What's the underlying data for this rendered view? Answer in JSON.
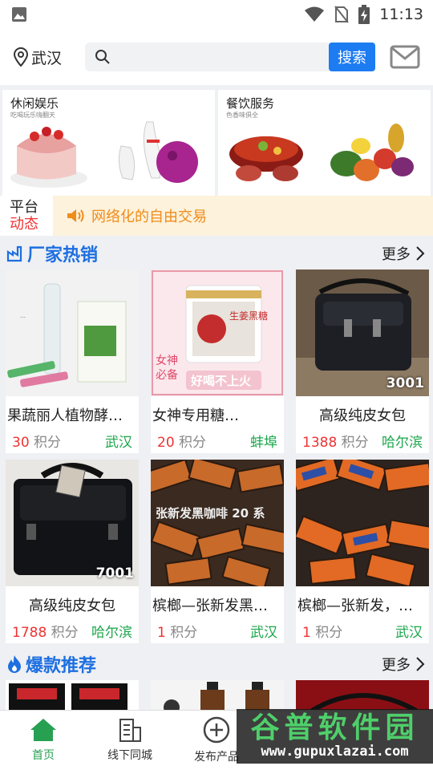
{
  "status": {
    "time": "11:13"
  },
  "header": {
    "location": "武汉",
    "search_placeholder": "",
    "search_button": "搜索"
  },
  "banners": [
    {
      "title": "休闲娱乐",
      "subtitle": "吃喝玩乐嗨翻天"
    },
    {
      "title": "餐饮服务",
      "subtitle": "色香味俱全"
    }
  ],
  "notice": {
    "label_line1": "平台",
    "label_line2": "动态",
    "message": "网络化的自由交易"
  },
  "sections": {
    "factory": {
      "title": "厂家热销",
      "more": "更多"
    },
    "hot": {
      "title": "爆款推荐",
      "more": "更多"
    }
  },
  "products": [
    {
      "name": "果蔬丽人植物酵…",
      "points": "30",
      "unit": "积分",
      "city": "武汉",
      "badge": ""
    },
    {
      "name": "女神专用糖…",
      "points": "20",
      "unit": "积分",
      "city": "蚌埠",
      "badge": ""
    },
    {
      "name": "高级纯皮女包",
      "points": "1388",
      "unit": "积分",
      "city": "哈尔滨",
      "badge": "3001"
    },
    {
      "name": "高级纯皮女包",
      "points": "1788",
      "unit": "积分",
      "city": "哈尔滨",
      "badge": "7001"
    },
    {
      "name": "槟榔—张新发黑…",
      "points": "1",
      "unit": "积分",
      "city": "武汉",
      "badge": ""
    },
    {
      "name": "槟榔—张新发，…",
      "points": "1",
      "unit": "积分",
      "city": "武汉",
      "badge": ""
    }
  ],
  "image_text": {
    "coffee": "张新发黑咖啡 20 系",
    "goddess_top": "女神",
    "goddess_mid": "必备",
    "goddess_slogan": "好喝不上火",
    "jar_label": "生姜黑糖"
  },
  "tabbar": [
    {
      "label": "首页",
      "active": true
    },
    {
      "label": "线下同城",
      "active": false
    },
    {
      "label": "发布产品",
      "active": false
    }
  ],
  "watermark": {
    "line1": "谷普软件园",
    "line2": "www.gupuxlazai.com"
  },
  "colors": {
    "accent": "#1d7cf2",
    "points_red": "#e33333",
    "city_green": "#1aa64a",
    "section_blue": "#1e6fe0",
    "tab_active": "#27a052"
  }
}
